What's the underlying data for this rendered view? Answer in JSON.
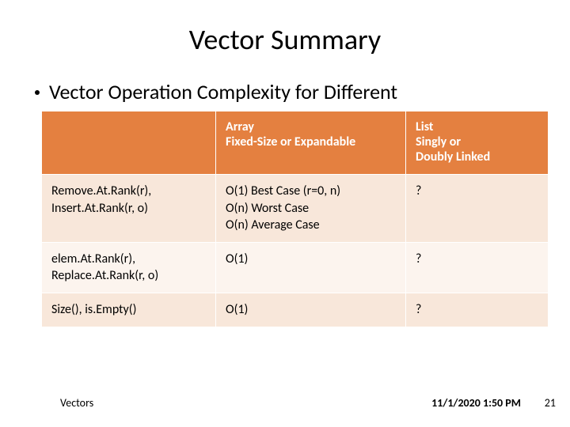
{
  "title": "Vector Summary",
  "bullet": "Vector Operation Complexity for Different",
  "chart_data": {
    "type": "table",
    "columns": [
      "",
      "Array\nFixed-Size or Expandable",
      "List\nSingly or\nDoubly Linked"
    ],
    "rows": [
      [
        "Remove.At.Rank(r),\nInsert.At.Rank(r, o)",
        "O(1) Best Case (r=0, n)\nO(n) Worst Case\nO(n) Average Case",
        "?"
      ],
      [
        "elem.At.Rank(r),\nReplace.At.Rank(r, o)",
        "O(1)",
        "?"
      ],
      [
        "Size(), is.Empty()",
        "O(1)",
        "?"
      ]
    ]
  },
  "header": {
    "col0": "",
    "col1_line1": "Array",
    "col1_line2": "Fixed-Size or Expandable",
    "col2_line1": "List",
    "col2_line2": "Singly or",
    "col2_line3": "Doubly Linked"
  },
  "row0": {
    "op_line1": "Remove.At.Rank(r),",
    "op_line2": "Insert.At.Rank(r, o)",
    "arr_line1": "O(1) Best Case (r=0, n)",
    "arr_line2": "O(n) Worst Case",
    "arr_line3": "O(n) Average Case",
    "list": "?"
  },
  "row1": {
    "op_line1": "elem.At.Rank(r),",
    "op_line2": "Replace.At.Rank(r, o)",
    "arr": "O(1)",
    "list": "?"
  },
  "row2": {
    "op": "Size(), is.Empty()",
    "arr": "O(1)",
    "list": "?"
  },
  "footer": {
    "left": "Vectors",
    "timestamp": "11/1/2020 1:50 PM",
    "page": "21"
  }
}
